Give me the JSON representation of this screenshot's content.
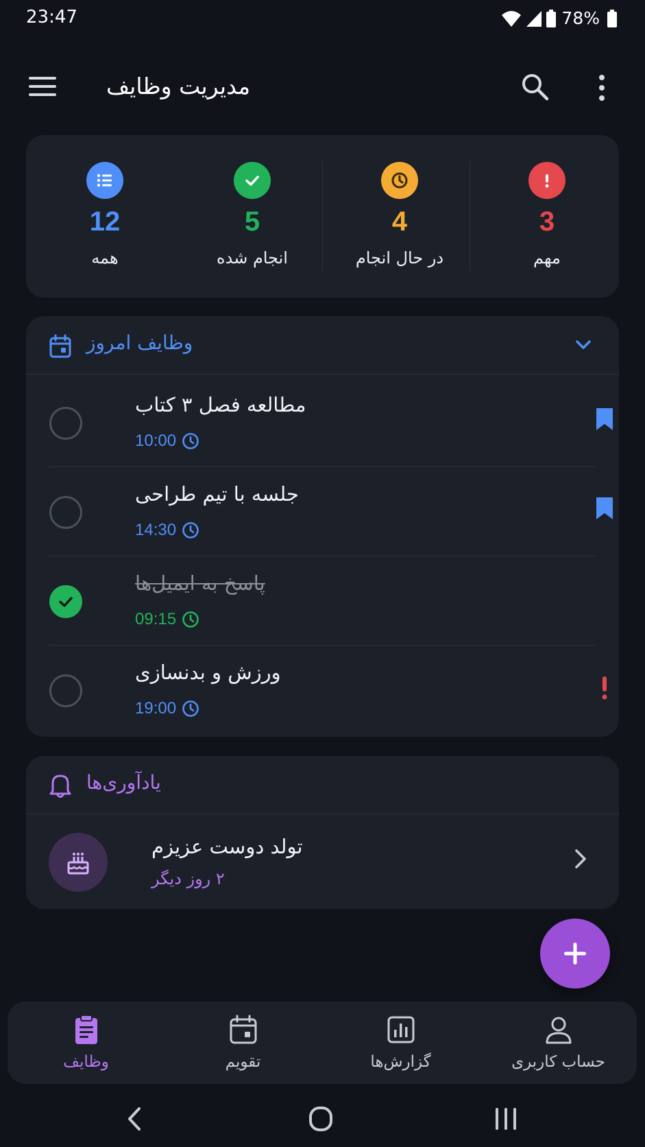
{
  "status_bar": {
    "time": "23:47",
    "battery": "78%",
    "icons": [
      "wifi-icon",
      "signal-icon",
      "battery-icon"
    ]
  },
  "app_bar": {
    "title": "مدیریت وظایف",
    "icons": [
      "menu-icon",
      "search-icon",
      "more-vert-icon"
    ]
  },
  "stats": [
    {
      "value": "12",
      "label": "همه",
      "color": "#4f8ff7",
      "icon": "list-icon"
    },
    {
      "value": "5",
      "label": "انجام شده",
      "color": "#22b35a",
      "icon": "check-icon"
    },
    {
      "value": "4",
      "label": "در حال انجام",
      "color": "#f4ab33",
      "icon": "clock-icon"
    },
    {
      "value": "3",
      "label": "مهم",
      "color": "#e5484d",
      "icon": "exclamation-icon"
    }
  ],
  "today": {
    "title": "وظایف امروز",
    "accent": "#4f8ff7",
    "icon": "calendar-icon",
    "tasks": [
      {
        "title": "مطالعه فصل ۳ کتاب",
        "time": "10:00",
        "done": false,
        "marker": "bookmark"
      },
      {
        "title": "جلسه با تیم طراحی",
        "time": "14:30",
        "done": false,
        "marker": "bookmark"
      },
      {
        "title": "پاسخ به ایمیل‌ها",
        "time": "09:15",
        "done": true,
        "marker": "none"
      },
      {
        "title": "ورزش و بدنسازی",
        "time": "19:00",
        "done": false,
        "marker": "important"
      }
    ]
  },
  "reminders": {
    "title": "یادآوری‌ها",
    "accent": "#b577f0",
    "icon": "bell-icon",
    "items": [
      {
        "title": "تولد دوست عزیزم",
        "subtitle": "۲ روز دیگر",
        "icon": "cake-icon"
      }
    ]
  },
  "fab": {
    "icon": "plus-icon",
    "color": "#9a4fd6"
  },
  "bottom_nav": [
    {
      "label": "وظایف",
      "icon": "clipboard-icon",
      "active": true
    },
    {
      "label": "تقویم",
      "icon": "calendar-icon",
      "active": false
    },
    {
      "label": "گزارش‌ها",
      "icon": "chart-icon",
      "active": false
    },
    {
      "label": "حساب کاربری",
      "icon": "user-icon",
      "active": false
    }
  ],
  "colors": {
    "background": "#10131a",
    "card": "#1c2029",
    "nav_active": "#b577f0",
    "nav_inactive": "#c7cbd3"
  }
}
